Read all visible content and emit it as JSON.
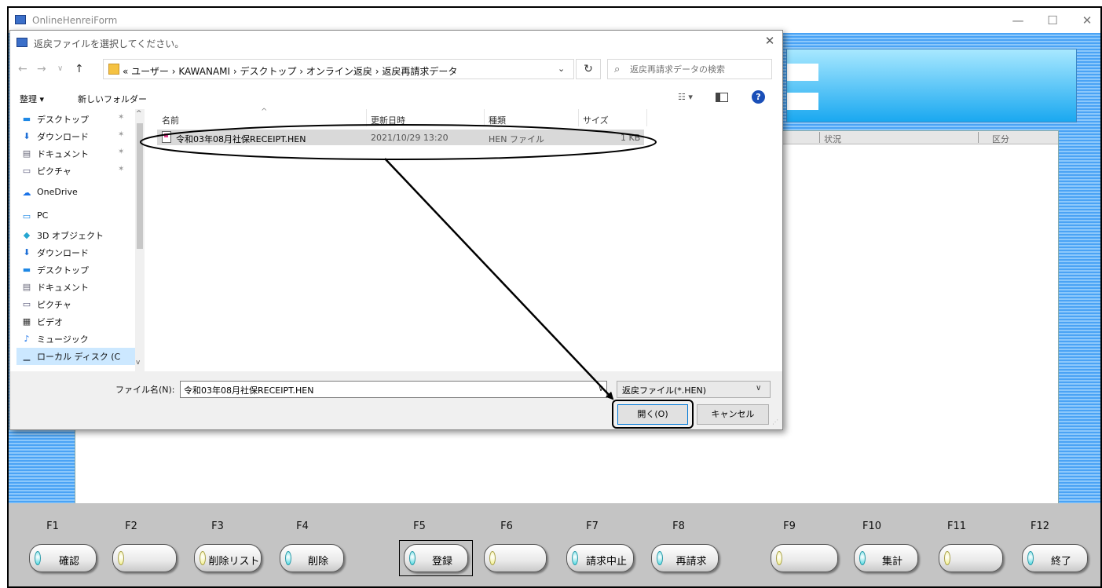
{
  "window": {
    "title": "OnlineHenreiForm",
    "minimize": "—",
    "maximize": "☐",
    "close": "✕"
  },
  "grid": {
    "headers": [
      "状況",
      "区分"
    ]
  },
  "function_keys": [
    {
      "key": "F1",
      "label": "確認",
      "led": "cyan"
    },
    {
      "key": "F2",
      "label": "",
      "led": "yellow"
    },
    {
      "key": "F3",
      "label": "削除リスト",
      "led": "yellow"
    },
    {
      "key": "F4",
      "label": "削除",
      "led": "cyan"
    },
    {
      "key": "F5",
      "label": "登録",
      "led": "cyan"
    },
    {
      "key": "F6",
      "label": "",
      "led": "yellow"
    },
    {
      "key": "F7",
      "label": "請求中止",
      "led": "cyan"
    },
    {
      "key": "F8",
      "label": "再請求",
      "led": "cyan"
    },
    {
      "key": "F9",
      "label": "",
      "led": "yellow"
    },
    {
      "key": "F10",
      "label": "集計",
      "led": "cyan"
    },
    {
      "key": "F11",
      "label": "",
      "led": "yellow"
    },
    {
      "key": "F12",
      "label": "終了",
      "led": "cyan"
    }
  ],
  "dialog": {
    "title": "返戻ファイルを選択してください。",
    "close": "✕",
    "nav": {
      "back": "←",
      "forward": "→",
      "recent": "∨",
      "up": "↑"
    },
    "address": "« ユーザー › KAWANAMI › デスクトップ › オンライン返戻 › 返戻再請求データ",
    "refresh": "↻",
    "search_placeholder": "返戻再請求データの検索",
    "toolbar": {
      "organize": "整理 ▾",
      "new_folder": "新しいフォルダー",
      "view": "☷ ▾"
    },
    "nav_pane": [
      {
        "label": "デスクトップ",
        "pinned": true,
        "icon": "desktop-icon",
        "glyph": "▬",
        "color": "#1e88e5"
      },
      {
        "label": "ダウンロード",
        "pinned": true,
        "icon": "download-icon",
        "glyph": "⬇",
        "color": "#1e6fd6"
      },
      {
        "label": "ドキュメント",
        "pinned": true,
        "icon": "document-icon",
        "glyph": "▤",
        "color": "#667"
      },
      {
        "label": "ピクチャ",
        "pinned": true,
        "icon": "picture-icon",
        "glyph": "▭",
        "color": "#557"
      },
      {
        "label": "OneDrive",
        "pinned": false,
        "icon": "cloud-icon",
        "glyph": "☁",
        "color": "#1a73e8"
      },
      {
        "label": "PC",
        "pinned": false,
        "icon": "pc-icon",
        "glyph": "▭",
        "color": "#1e88e5"
      },
      {
        "label": "3D オブジェクト",
        "pinned": false,
        "icon": "cube-icon",
        "glyph": "◆",
        "color": "#26a6d1"
      },
      {
        "label": "ダウンロード",
        "pinned": false,
        "icon": "download-icon",
        "glyph": "⬇",
        "color": "#1e6fd6"
      },
      {
        "label": "デスクトップ",
        "pinned": false,
        "icon": "desktop-icon",
        "glyph": "▬",
        "color": "#1e88e5"
      },
      {
        "label": "ドキュメント",
        "pinned": false,
        "icon": "document-icon",
        "glyph": "▤",
        "color": "#667"
      },
      {
        "label": "ピクチャ",
        "pinned": false,
        "icon": "picture-icon",
        "glyph": "▭",
        "color": "#557"
      },
      {
        "label": "ビデオ",
        "pinned": false,
        "icon": "video-icon",
        "glyph": "▦",
        "color": "#333"
      },
      {
        "label": "ミュージック",
        "pinned": false,
        "icon": "music-icon",
        "glyph": "♪",
        "color": "#1a73e8"
      },
      {
        "label": "ローカル ディスク (C",
        "pinned": false,
        "icon": "disk-icon",
        "glyph": "▁",
        "color": "#456"
      }
    ],
    "columns": [
      "名前",
      "更新日時",
      "種類",
      "サイズ"
    ],
    "files": [
      {
        "name": "令和03年08月社保RECEIPT.HEN",
        "modified": "2021/10/29 13:20",
        "type": "HEN ファイル",
        "size": "1 KB"
      }
    ],
    "filename_label": "ファイル名(N):",
    "filename_value": "令和03年08月社保RECEIPT.HEN",
    "filetype": "返戻ファイル(*.HEN)",
    "open_button": "開く(O)",
    "cancel_button": "キャンセル"
  },
  "colors": {
    "form_stripe": "#4aa3f5",
    "accent": "#0078d7",
    "led_cyan": "#4bd8e0",
    "led_yellow": "#f2f08a"
  }
}
